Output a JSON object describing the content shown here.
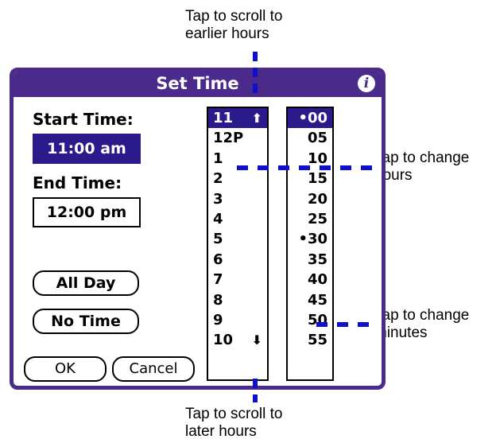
{
  "callouts": {
    "top": [
      "Tap to scroll to",
      "earlier hours"
    ],
    "hours": [
      "Tap to change",
      "hours"
    ],
    "minutes": [
      "Tap to change",
      "minutes"
    ],
    "bottom": [
      "Tap to scroll to",
      "later hours"
    ]
  },
  "dialog": {
    "title": "Set Time",
    "info_icon": "i",
    "start_label": "Start Time:",
    "start_value": "11:00 am",
    "end_label": "End Time:",
    "end_value": "12:00 pm",
    "all_day": "All Day",
    "no_time": "No Time",
    "ok": "OK",
    "cancel": "Cancel"
  },
  "hours": [
    "11",
    "12P",
    "1",
    "2",
    "3",
    "4",
    "5",
    "6",
    "7",
    "8",
    "9",
    "10"
  ],
  "minutes": [
    "•00",
    "05",
    "10",
    "15",
    "20",
    "25",
    "•30",
    "35",
    "40",
    "45",
    "50",
    "55"
  ],
  "icons": {
    "scroll_up": "up-arrow-icon",
    "scroll_down": "down-arrow-icon",
    "info": "info-icon"
  },
  "colors": {
    "accent": "#4a2a8a",
    "selection": "#2a1a8c",
    "leader": "#1010cc"
  }
}
